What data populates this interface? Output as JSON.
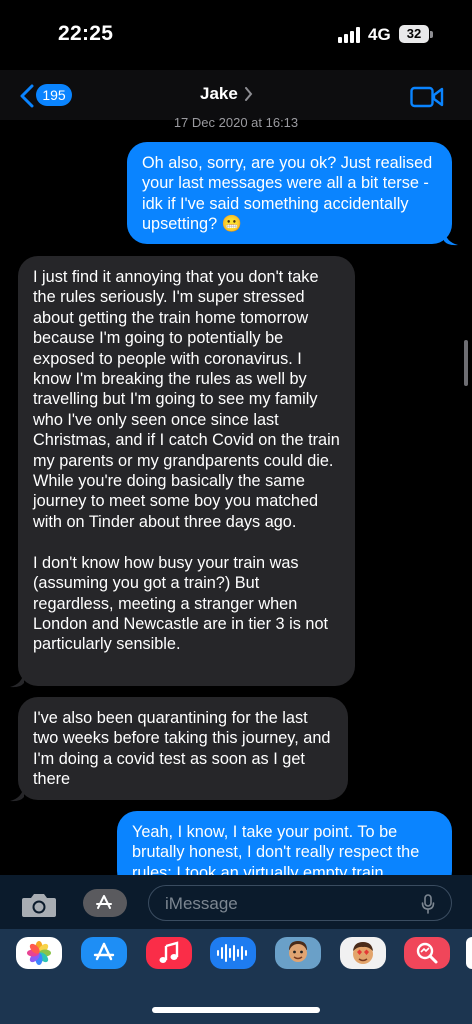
{
  "status_bar": {
    "time": "22:25",
    "network": "4G",
    "battery": "32"
  },
  "header": {
    "back_count": "195",
    "contact_name": "Jake"
  },
  "conversation": {
    "timestamp": "17 Dec 2020 at 16:13",
    "messages": [
      {
        "direction": "sent",
        "text": "Oh also, sorry, are you ok? Just realised your last messages were all a bit terse - idk if I've said something accidentally upsetting? 😬"
      },
      {
        "direction": "received",
        "text": "I just find it annoying that you don't take the rules seriously. I'm super stressed about getting the train home tomorrow because I'm going to potentially be exposed to people with coronavirus. I know I'm breaking the rules as well by travelling but I'm going to see my family who I've only seen once since last Christmas, and if I catch Covid on the train my parents or my grandparents could die. While you're doing basically the same journey to meet some boy you matched with on Tinder about three days ago.\n\nI don't know how busy your train was (assuming you got a train?) But regardless, meeting a stranger when London and Newcastle are in tier 3 is not particularly sensible."
      },
      {
        "direction": "received",
        "text": "I've also been quarantining for the last two weeks before taking this journey, and I'm doing a covid test as soon as I get there"
      },
      {
        "direction": "sent",
        "text": "Yeah, I know, I take your point. To be brutally honest, I don't really respect the rules: I took an virtually empty train"
      }
    ]
  },
  "compose": {
    "placeholder": "iMessage"
  },
  "app_drawer": {
    "apps": [
      "photos-icon",
      "app-store-icon",
      "music-icon",
      "audio-message-icon",
      "memoji-icon",
      "memoji-stickers-icon",
      "search-images-icon"
    ]
  },
  "colors": {
    "sent_bubble": "#0a84ff",
    "received_bubble": "#262629",
    "background": "#000000"
  }
}
